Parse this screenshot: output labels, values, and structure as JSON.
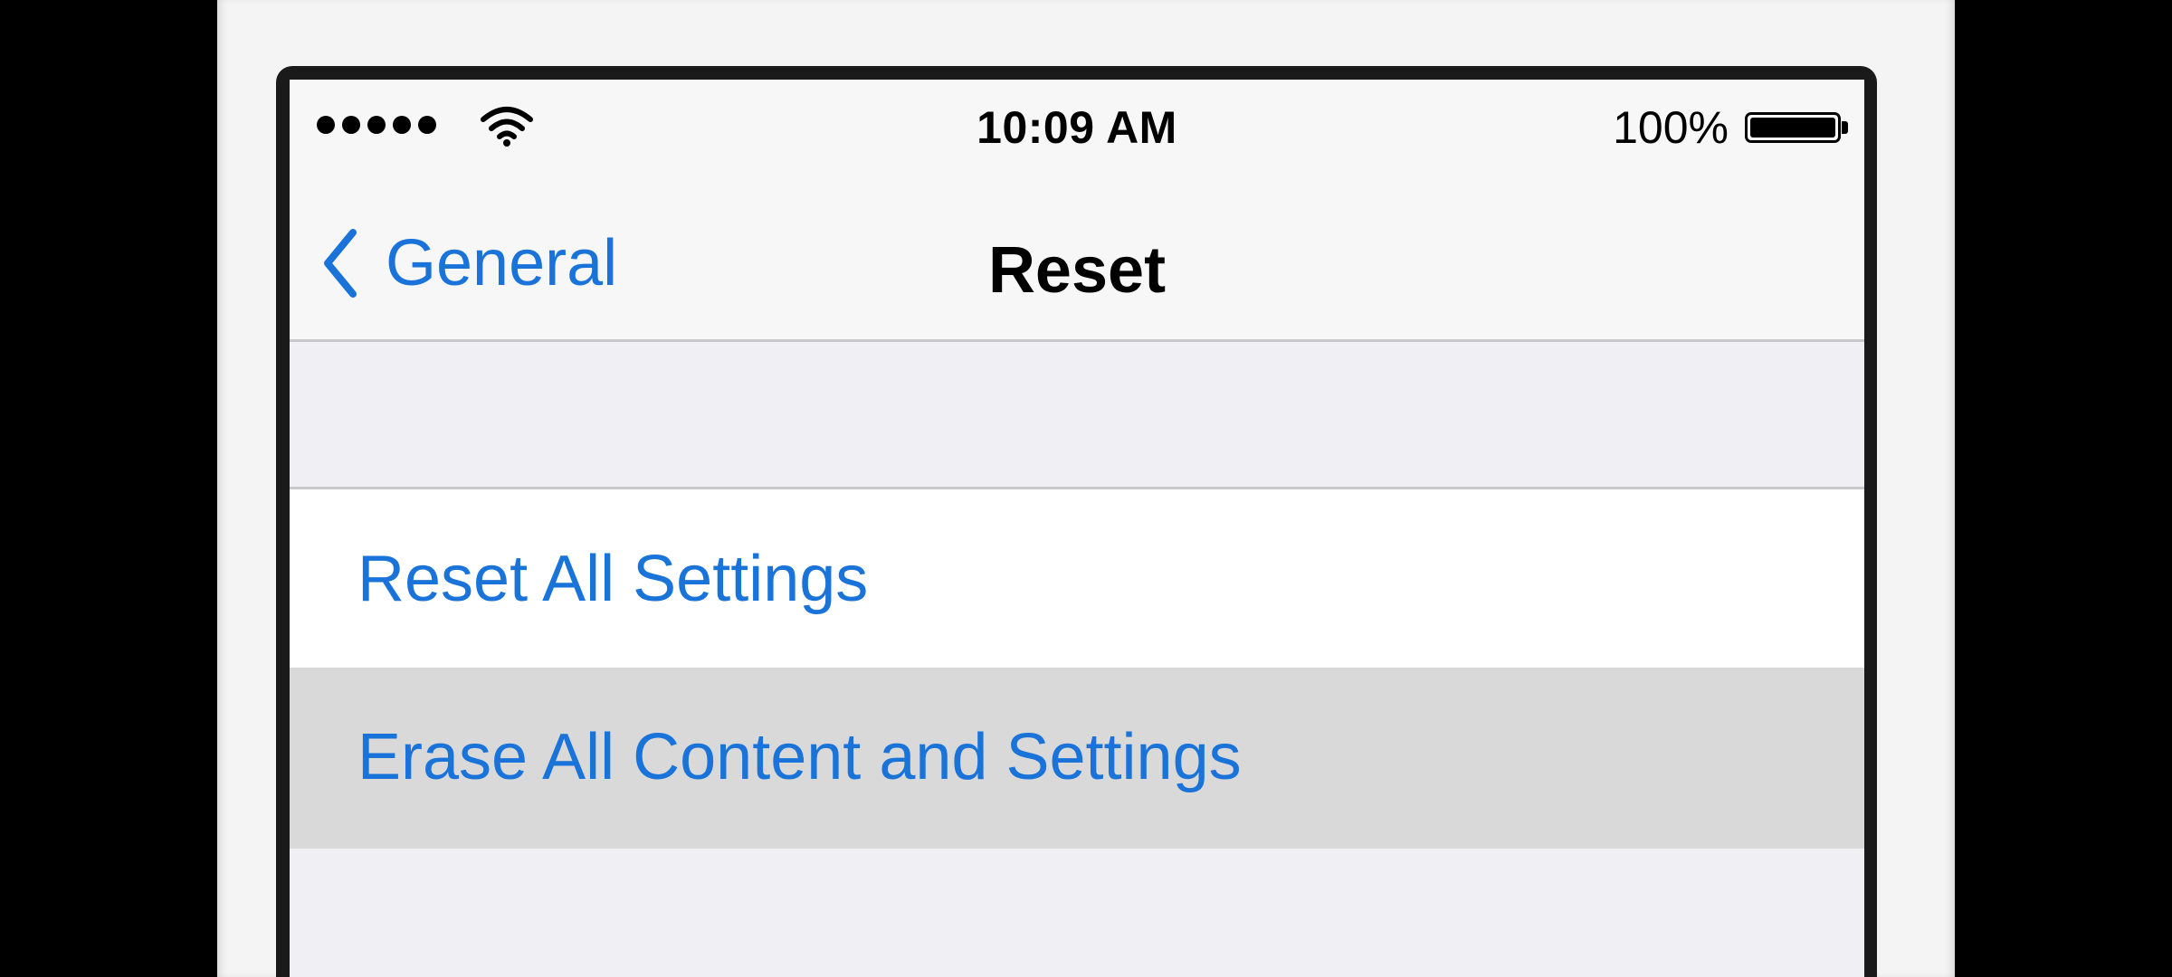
{
  "status_bar": {
    "time": "10:09 AM",
    "battery_percent": "100%",
    "battery_level": 1.0,
    "signal_bars": 5,
    "signal_icon": "signal-dots-icon",
    "wifi_icon": "wifi-icon",
    "battery_icon": "battery-icon"
  },
  "nav": {
    "back_label": "General",
    "back_icon": "chevron-left-icon",
    "title": "Reset"
  },
  "list": {
    "items": [
      {
        "label": "Reset All Settings",
        "highlighted": false
      },
      {
        "label": "Erase All Content and Settings",
        "highlighted": true
      }
    ]
  },
  "colors": {
    "accent": "#1a73d9",
    "highlight_row": "#d9d9d9",
    "grouped_background": "#efeff4",
    "separator": "#c8c7cc"
  }
}
